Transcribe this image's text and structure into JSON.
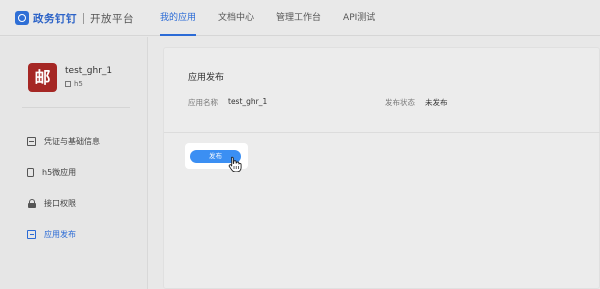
{
  "brand": {
    "name": "政务钉钉",
    "sub": "开放平台"
  },
  "nav": {
    "items": [
      {
        "label": "我的应用",
        "active": true
      },
      {
        "label": "文档中心",
        "active": false
      },
      {
        "label": "管理工作台",
        "active": false
      },
      {
        "label": "API测试",
        "active": false
      }
    ]
  },
  "app": {
    "icon_char": "邮",
    "name": "test_ghr_1",
    "type": "h5"
  },
  "sidebar": {
    "items": [
      {
        "label": "凭证与基础信息",
        "icon": "certificate-icon",
        "active": false
      },
      {
        "label": "h5微应用",
        "icon": "mobile-icon",
        "active": false
      },
      {
        "label": "接口权限",
        "icon": "lock-icon",
        "active": false
      },
      {
        "label": "应用发布",
        "icon": "publish-icon",
        "active": true
      }
    ]
  },
  "main": {
    "title": "应用发布",
    "fields": {
      "name_label": "应用名称",
      "name_value": "test_ghr_1",
      "status_label": "发布状态",
      "status_value": "未发布"
    },
    "publish_button": "发布"
  },
  "colors": {
    "accent": "#2b6bd6",
    "button": "#3b8ff3",
    "app_icon": "#a52724"
  }
}
